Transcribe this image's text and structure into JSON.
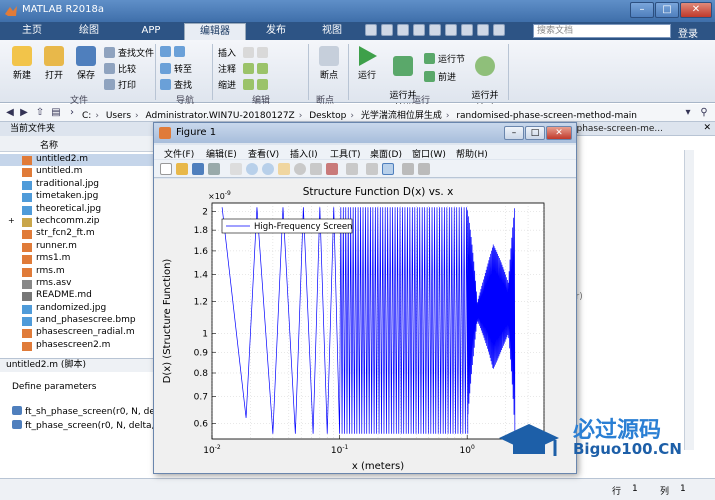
{
  "window": {
    "title": "MATLAB R2018a"
  },
  "tabs": [
    {
      "label": "主页"
    },
    {
      "label": "绘图"
    },
    {
      "label": "APP"
    },
    {
      "label": "编辑器"
    },
    {
      "label": "发布"
    },
    {
      "label": "视图"
    }
  ],
  "search": {
    "placeholder": "搜索文档"
  },
  "login": "登录",
  "ribbon": {
    "new": "新建",
    "open": "打开",
    "save": "保存",
    "find_files": "查找文件",
    "compare": "比较",
    "print": "打印",
    "goto": "转至",
    "find": "查找",
    "insert": "插入",
    "comment": "注释",
    "indent": "缩进",
    "breakpoints": "断点",
    "run": "运行",
    "run_advance": "运行并\n前进",
    "run_section": "运行节",
    "advance": "前进",
    "run_time": "运行并\n计时",
    "groups": {
      "file": "文件",
      "nav": "导航",
      "edit": "编辑",
      "bp": "断点",
      "run": "运行"
    }
  },
  "address": {
    "segments": [
      "C:",
      "Users",
      "Administrator.WIN7U-20180127Z",
      "Desktop",
      "光学湍流相位屏生成",
      "randomised-phase-screen-method-main"
    ]
  },
  "left_panel": {
    "title": "当前文件夹",
    "column": "名称",
    "files": [
      {
        "name": "untitled2.m",
        "type": "m",
        "selected": true
      },
      {
        "name": "untitled.m",
        "type": "m"
      },
      {
        "name": "traditional.jpg",
        "type": "jpg"
      },
      {
        "name": "timetaken.jpg",
        "type": "jpg"
      },
      {
        "name": "theoretical.jpg",
        "type": "jpg"
      },
      {
        "name": "techcomm.zip",
        "type": "zip",
        "expander": "+"
      },
      {
        "name": "str_fcn2_ft.m",
        "type": "m"
      },
      {
        "name": "runner.m",
        "type": "m"
      },
      {
        "name": "rms1.m",
        "type": "m"
      },
      {
        "name": "rms.m",
        "type": "m"
      },
      {
        "name": "rms.asv",
        "type": "asv"
      },
      {
        "name": "README.md",
        "type": "md"
      },
      {
        "name": "randomized.jpg",
        "type": "jpg"
      },
      {
        "name": "rand_phasescree.bmp",
        "type": "bmp"
      },
      {
        "name": "phasescreen_radial.m",
        "type": "m"
      },
      {
        "name": "phasescreen2.m",
        "type": "m"
      }
    ],
    "detail_title": "untitled2.m (脚本)",
    "detail_heading": "Define parameters",
    "functions": [
      "ft_sh_phase_screen(r0, N, delt",
      "ft_phase_screen(r0, N, delta,"
    ]
  },
  "editor": {
    "tab_label": "ed-phase-screen-me...",
    "visible_fragment": "ar)"
  },
  "statusbar": {
    "row_label": "行",
    "row_value": "1",
    "col_label": "列",
    "col_value": "1"
  },
  "figure": {
    "title": "Figure 1",
    "menu": [
      "文件(F)",
      "编辑(E)",
      "查看(V)",
      "插入(I)",
      "工具(T)",
      "桌面(D)",
      "窗口(W)",
      "帮助(H)"
    ]
  },
  "chart_data": {
    "type": "line",
    "title": "Structure Function D(x) vs. x",
    "xlabel": "x (meters)",
    "ylabel": "D(x) (Structure Function)",
    "x_scale": "log",
    "y_scale": "log",
    "xlim": [
      0.01,
      4
    ],
    "ylim": [
      5.5e-10,
      2.1e-09
    ],
    "x_ticks": [
      "10^{-2}",
      "10^{-1}",
      "10^{0}"
    ],
    "y_ticks": [
      0.6,
      0.7,
      0.8,
      0.9,
      1,
      1.2,
      1.4,
      1.6,
      1.8,
      2
    ],
    "y_multiplier": "×10^{-9}",
    "grid": true,
    "legend_position": "top-left",
    "color": "#0000ff",
    "series": [
      {
        "name": "High-Frequency Screen",
        "description_points": [
          [
            0.012,
            2.05e-09
          ],
          [
            0.0185,
            6.2e-10
          ],
          [
            0.0225,
            2.05e-09
          ],
          [
            0.03,
            5.7e-10
          ],
          [
            0.036,
            2.05e-09
          ],
          [
            0.045,
            5.7e-10
          ],
          [
            0.052,
            2.05e-09
          ],
          [
            0.062,
            5.7e-10
          ],
          [
            0.07,
            2.05e-09
          ],
          [
            0.08,
            5.7e-10
          ],
          [
            0.09,
            2.05e-09
          ],
          [
            0.1,
            5.7e-10
          ],
          [
            1.0,
            5.7e-10
          ],
          [
            1.0,
            2.05e-09
          ],
          [
            1.2,
            1.15e-09
          ],
          [
            1.6,
            7.5e-10
          ],
          [
            1.6,
            1.6e-09
          ],
          [
            2.3,
            7e-10
          ],
          [
            2.3,
            2e-09
          ]
        ]
      }
    ]
  },
  "watermark": {
    "text1": "必过源码",
    "text2": "Biguo100.CN"
  }
}
